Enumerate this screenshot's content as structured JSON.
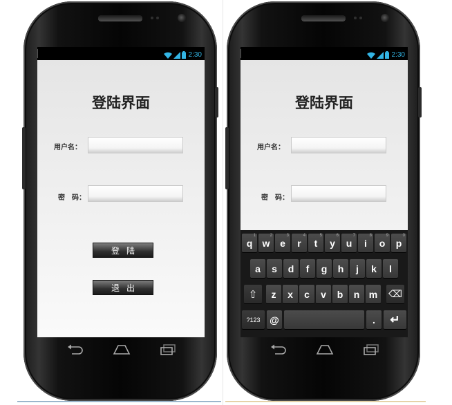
{
  "left_phone": {
    "status": {
      "time": "2:30"
    },
    "app": {
      "title": "登陆界面",
      "username_label": "用户名：",
      "username_value": "",
      "password_label": "密　码：",
      "password_value": "",
      "login_button": "登陆",
      "exit_button": "退出"
    }
  },
  "right_phone": {
    "status": {
      "time": "2:30"
    },
    "app": {
      "title": "登陆界面",
      "username_label": "用户名：",
      "username_value": "",
      "password_label": "密　码：",
      "password_value": ""
    },
    "keyboard": {
      "row1": [
        {
          "key": "q",
          "hint": "1"
        },
        {
          "key": "w",
          "hint": "2"
        },
        {
          "key": "e",
          "hint": "3"
        },
        {
          "key": "r",
          "hint": "4"
        },
        {
          "key": "t",
          "hint": "5"
        },
        {
          "key": "y",
          "hint": "6"
        },
        {
          "key": "u",
          "hint": "7"
        },
        {
          "key": "i",
          "hint": "8"
        },
        {
          "key": "o",
          "hint": "9"
        },
        {
          "key": "p",
          "hint": "0"
        }
      ],
      "row2": [
        "a",
        "s",
        "d",
        "f",
        "g",
        "h",
        "j",
        "k",
        "l"
      ],
      "row3": [
        "z",
        "x",
        "c",
        "v",
        "b",
        "n",
        "m"
      ],
      "shift": "⇧",
      "backspace": "⌫",
      "symbols": "?123",
      "at": "@",
      "space": "",
      "period": ".",
      "enter": "↵"
    }
  },
  "icons": {
    "wifi": "wifi-icon",
    "signal": "signal-icon",
    "battery": "battery-icon",
    "back": "back-icon",
    "home": "home-icon",
    "recent": "recent-apps-icon"
  },
  "colors": {
    "status_accent": "#33b5e5",
    "app_background": "#ececec",
    "button_dark": "#2f2f2f",
    "keyboard_background": "#191919"
  }
}
